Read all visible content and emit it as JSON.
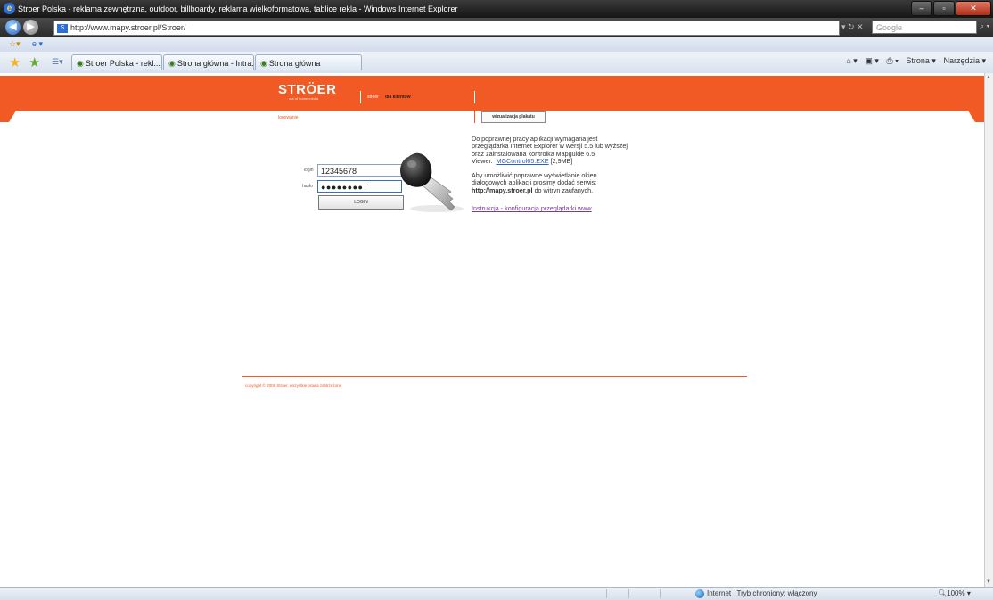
{
  "window": {
    "title": "Stroer Polska - reklama zewnętrzna, outdoor, billboardy, reklama wielkoformatowa, tablice rekla - Windows Internet Explorer",
    "minimize": "–",
    "maximize": "▫",
    "close": "✕"
  },
  "address": {
    "url": "http://www.mapy.stroer.pl/Stroer/",
    "search_placeholder": "Google"
  },
  "tabs": [
    {
      "label": "Stroer Polska - rekl..."
    },
    {
      "label": "Strona główna - Intra..."
    },
    {
      "label": "Strona główna"
    }
  ],
  "commandbar": {
    "page": "Strona ▾",
    "tools": "Narzędzia ▾"
  },
  "site": {
    "logo": "STRÖER",
    "tagline": "out of home media",
    "nav": [
      "stroer",
      "dla klientów"
    ],
    "logout": "logowanie",
    "wizard_button": "wizualizacja plakatu",
    "login_label": "login",
    "password_label": "hasło",
    "login_value": "12345678",
    "password_value": "●●●●●●●●",
    "submit": "LOGIN",
    "info_p1_a": "Do poprawnej pracy aplikacji wymagana jest przeglądarka Internet Explorer w wersji 5.5 lub wyższej oraz zainstalowana kontrolka Mapguide 6.5 Viewer.",
    "info_p1_link": "MGControl65.EXE",
    "info_p1_size": "[2,9MB]",
    "info_p2_a": "Aby umożliwić poprawne wyświetlanie okien dialogowych aplikacji prosimy dodać serwis:",
    "info_p2_site": "http://mapy.stroer.pl",
    "info_p2_b": "do witryn zaufanych.",
    "instr_link": "Instrukcja - konfiguracja przeglądarki www",
    "copyright": "copyright © 2006 Ströer, wszystkie prawa zastrzeżone"
  },
  "status": {
    "zone": "Internet | Tryb chroniony: włączony",
    "zoom": "100%"
  }
}
